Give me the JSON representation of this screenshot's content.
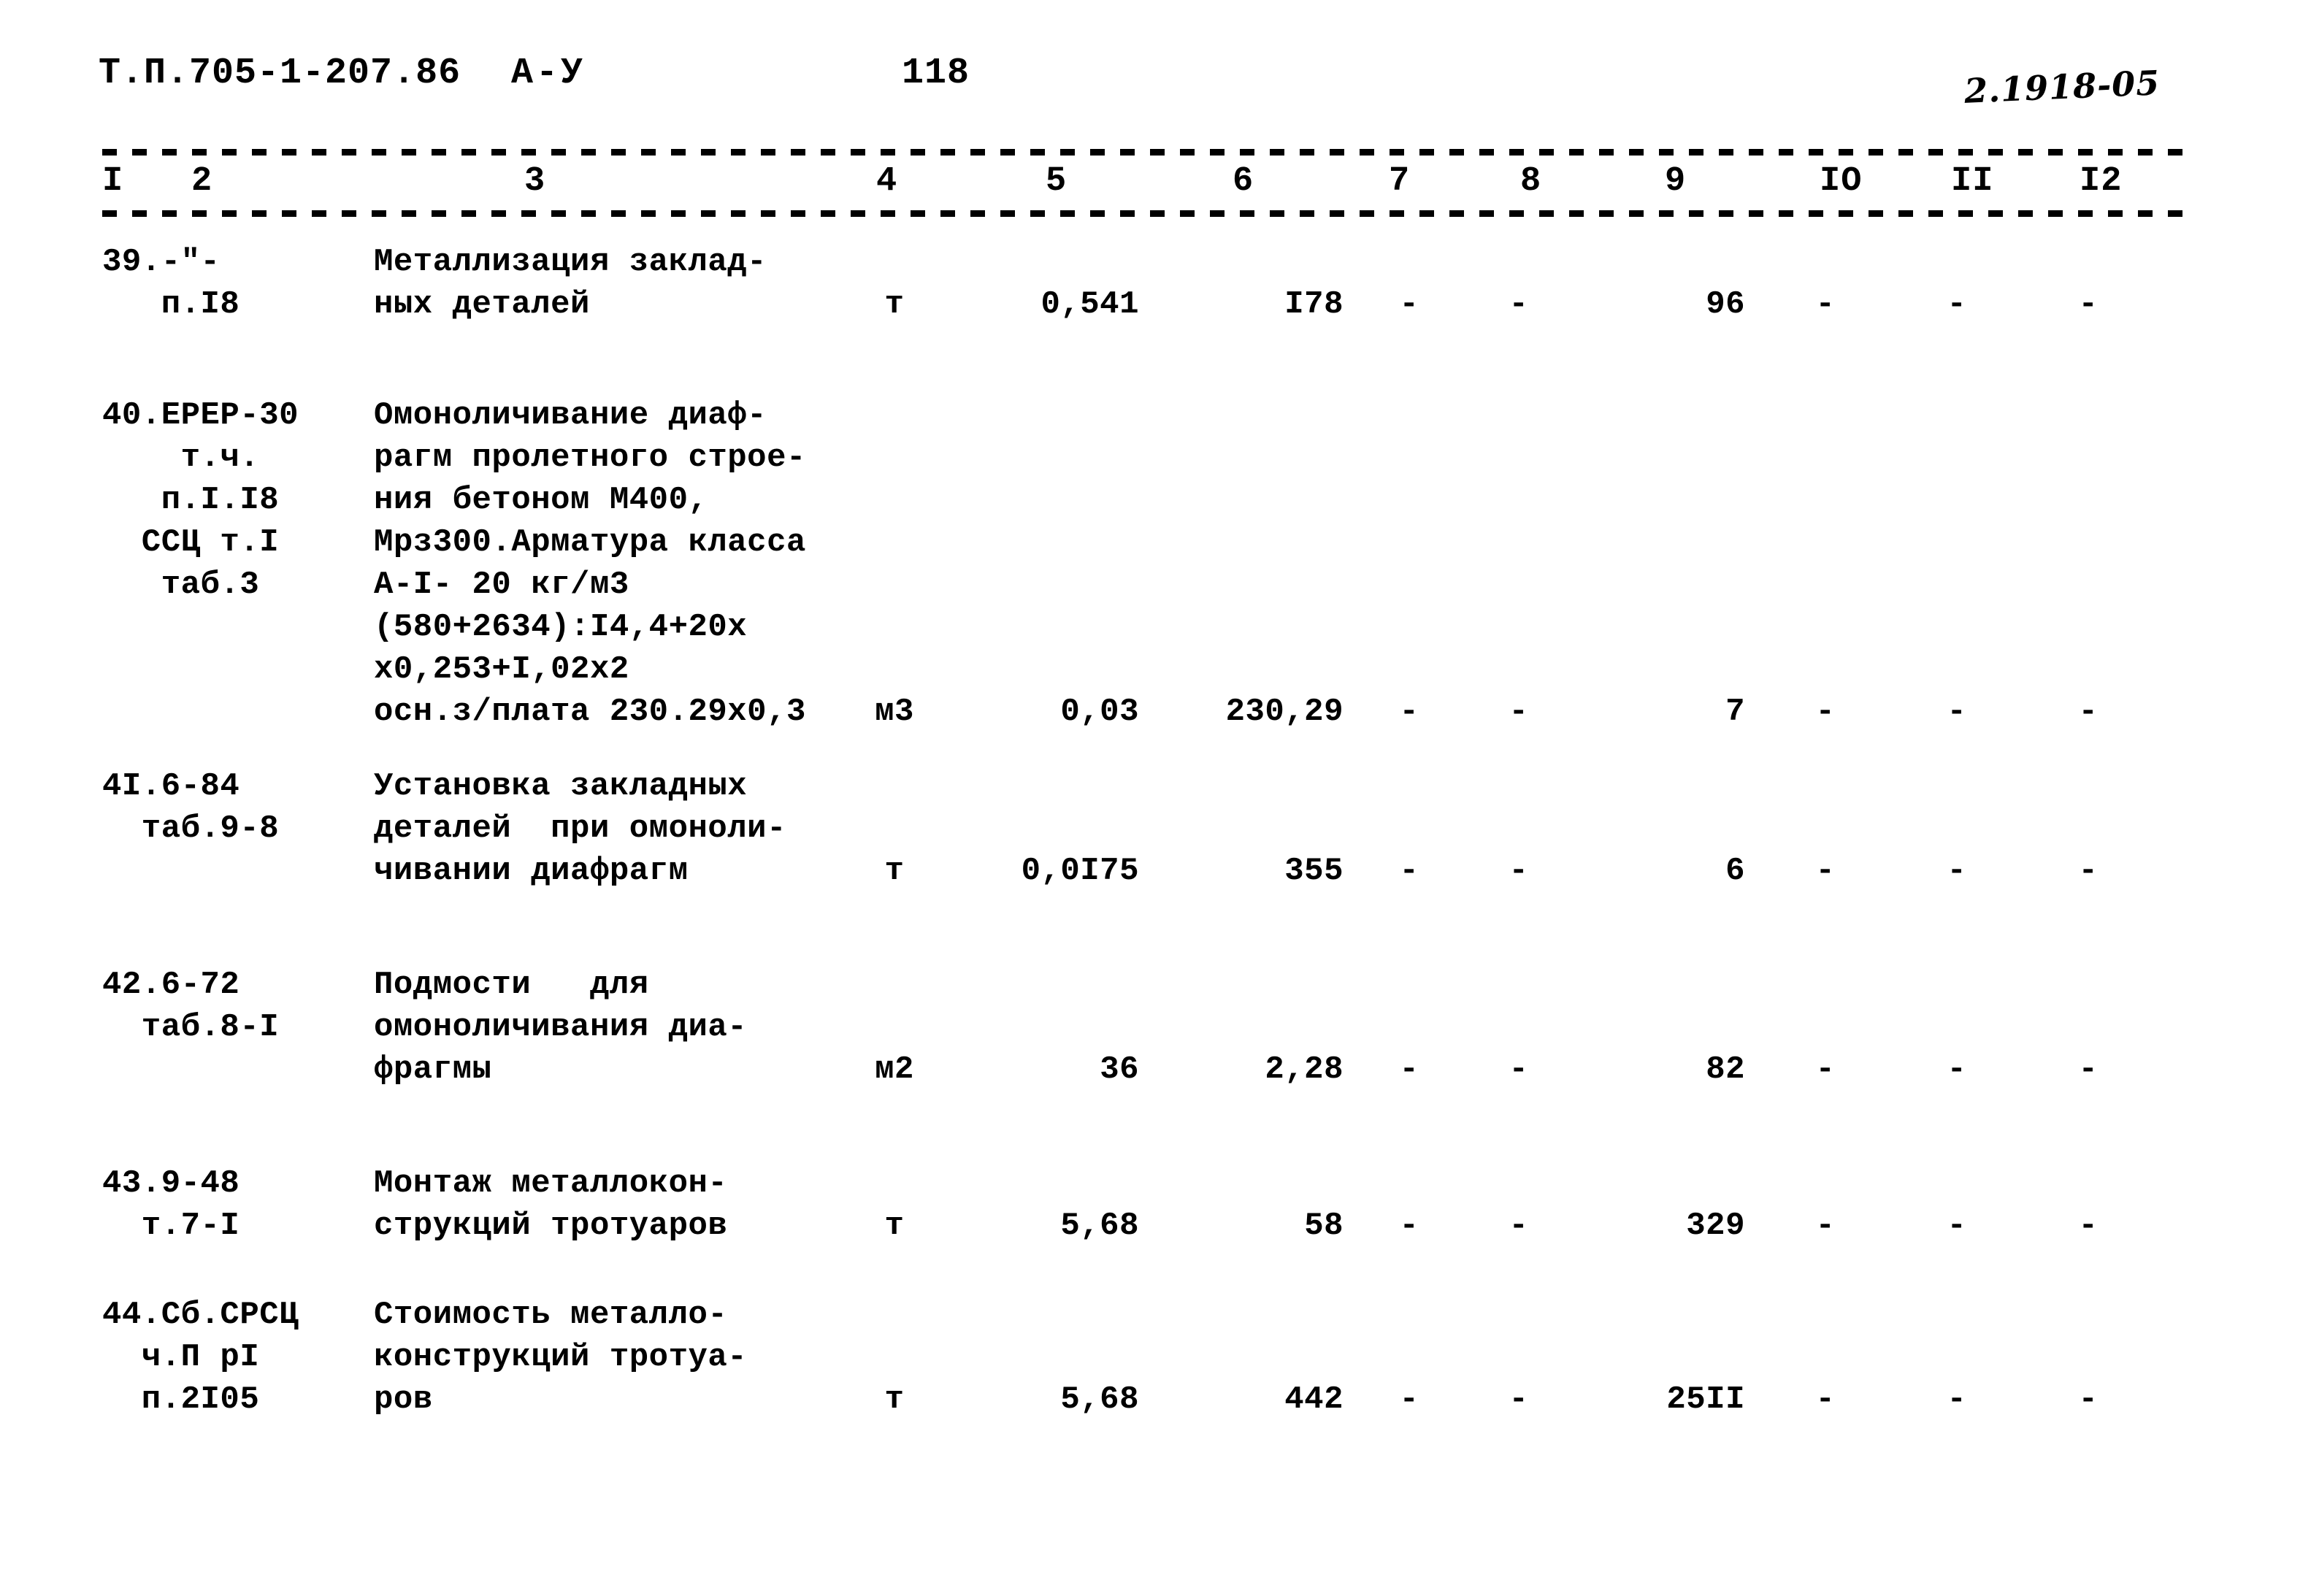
{
  "header": {
    "doc_code": "Т.П.705-1-207.86",
    "album": "А-У",
    "page_number": "118",
    "archive_stamp": "2.1918-05"
  },
  "table": {
    "column_numbers": [
      "I",
      "2",
      "3",
      "4",
      "5",
      "6",
      "7",
      "8",
      "9",
      "IO",
      "II",
      "I2"
    ],
    "rows": [
      {
        "code_lines": [
          "39.-\"-",
          "   п.I8"
        ],
        "name_lines": [
          "Металлизация заклад-",
          "ных деталей"
        ],
        "unit": "т",
        "col5": "0,541",
        "col6": "I78",
        "col7": "-",
        "col8": "-",
        "col9": "96",
        "col10": "-",
        "col11": "-",
        "col12": "-"
      },
      {
        "code_lines": [
          "40.ЕРЕР-30",
          "    т.ч.",
          "   п.I.I8",
          "  ССЦ т.I",
          "   таб.3"
        ],
        "name_lines": [
          "Омоноличивание диаф-",
          "рагм пролетного строе-",
          "ния бетоном М400,",
          "Мрз300.Арматура класса",
          "А-I- 20 кг/м3",
          "(580+2634):I4,4+20х",
          "х0,253+I,02х2",
          "осн.з/плата 230.29х0,3"
        ],
        "unit": "м3",
        "col5": "0,03",
        "col6": "230,29",
        "col7": "-",
        "col8": "-",
        "col9": "7",
        "col10": "-",
        "col11": "-",
        "col12": "-"
      },
      {
        "code_lines": [
          "4I.6-84",
          "  таб.9-8"
        ],
        "name_lines": [
          "Установка закладных",
          "деталей  при омоноли-",
          "чивании диафрагм"
        ],
        "unit": "т",
        "col5": "0,0I75",
        "col6": "355",
        "col7": "-",
        "col8": "-",
        "col9": "6",
        "col10": "-",
        "col11": "-",
        "col12": "-"
      },
      {
        "code_lines": [
          "42.6-72",
          "  таб.8-I"
        ],
        "name_lines": [
          "Подмости   для",
          "омоноличивания диа-",
          "фрагмы"
        ],
        "unit": "м2",
        "col5": "36",
        "col6": "2,28",
        "col7": "-",
        "col8": "-",
        "col9": "82",
        "col10": "-",
        "col11": "-",
        "col12": "-"
      },
      {
        "code_lines": [
          "43.9-48",
          "  т.7-I"
        ],
        "name_lines": [
          "Монтаж металлокон-",
          "струкций тротуаров"
        ],
        "unit": "т",
        "col5": "5,68",
        "col6": "58",
        "col7": "-",
        "col8": "-",
        "col9": "329",
        "col10": "-",
        "col11": "-",
        "col12": "-"
      },
      {
        "code_lines": [
          "44.Сб.СРСЦ",
          "  ч.П рI",
          "  п.2I05"
        ],
        "name_lines": [
          "Стоимость металло-",
          "конструкций тротуа-",
          "ров"
        ],
        "unit": "т",
        "col5": "5,68",
        "col6": "442",
        "col7": "-",
        "col8": "-",
        "col9": "25II",
        "col10": "-",
        "col11": "-",
        "col12": "-"
      }
    ]
  }
}
